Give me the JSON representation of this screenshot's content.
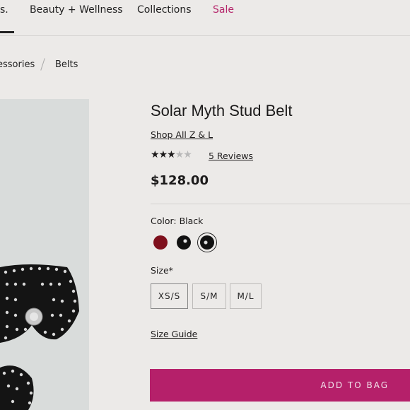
{
  "nav": {
    "items": [
      "s.",
      "Beauty + Wellness",
      "Collections",
      "Sale"
    ]
  },
  "breadcrumb": {
    "items": [
      "essories",
      "Belts"
    ]
  },
  "product": {
    "title": "Solar Myth Stud Belt",
    "shop_link": "Shop All Z & L",
    "rating": 3,
    "rating_max": 5,
    "reviews_label": "5 Reviews",
    "price": "$128.00"
  },
  "color": {
    "label": "Color: Black",
    "swatches": [
      {
        "name": "red",
        "hex": "#7e0f1c"
      },
      {
        "name": "black",
        "hex": "#111111"
      },
      {
        "name": "black",
        "hex": "#111111",
        "selected": true
      }
    ]
  },
  "size": {
    "label": "Size*",
    "options": [
      "XS/S",
      "S/M",
      "M/L"
    ]
  },
  "size_guide": "Size Guide",
  "add_to_bag": "ADD TO BAG",
  "colors": {
    "accent": "#b5206a",
    "sale": "#b5266b"
  }
}
